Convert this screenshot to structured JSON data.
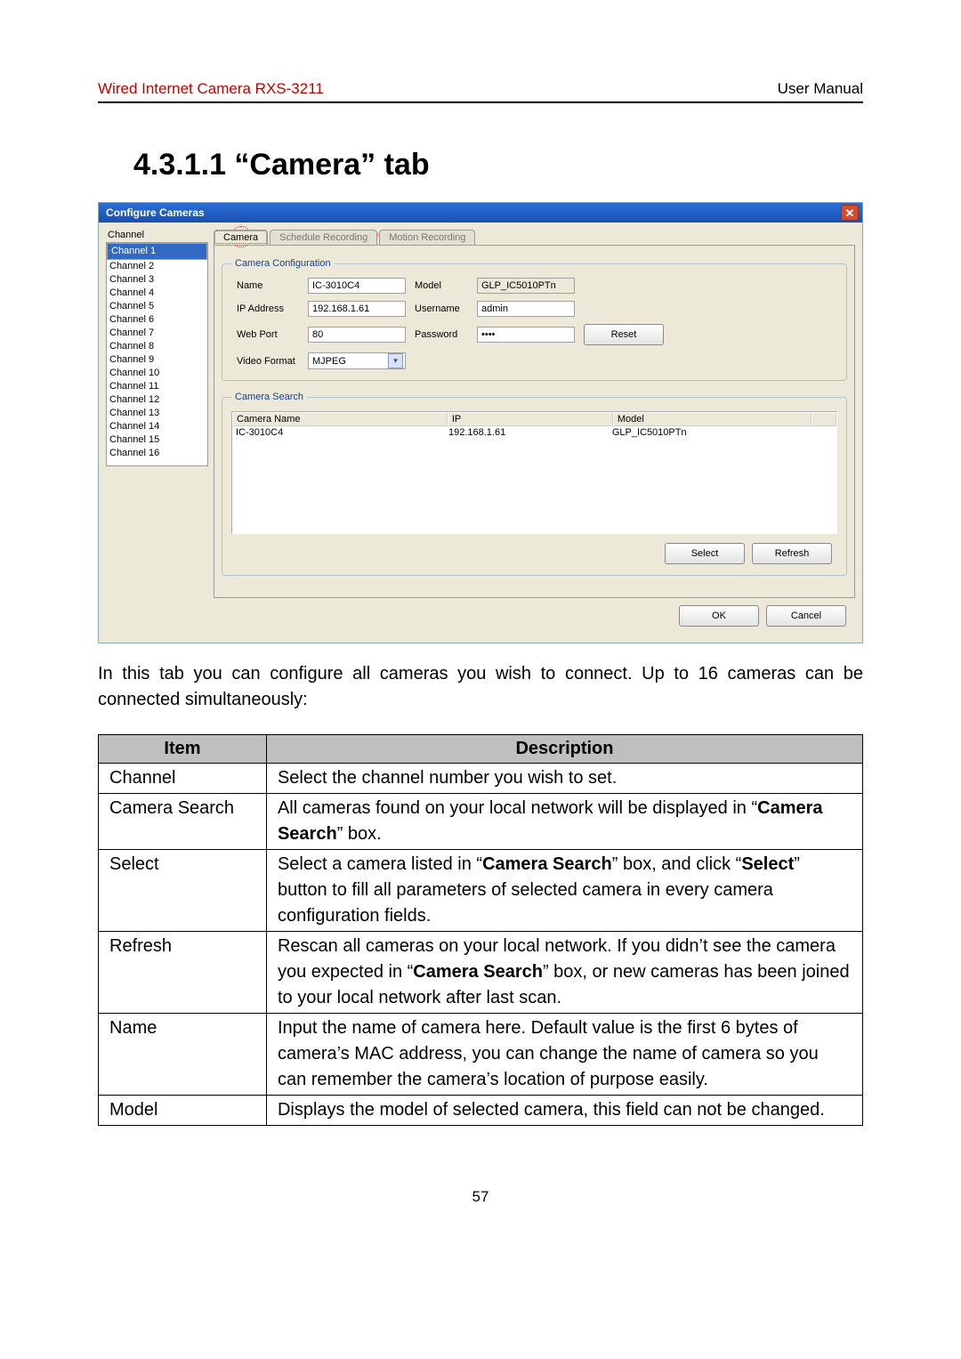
{
  "header": {
    "left": "Wired Internet Camera RXS-3211",
    "right": "User Manual"
  },
  "section_title": "4.3.1.1 “Camera” tab",
  "paragraph": "In this tab you can configure all cameras you wish to connect. Up to 16 cameras can be connected simultaneously:",
  "dialog": {
    "title": "Configure Cameras",
    "channel_label": "Channel",
    "channels": [
      "Channel 1",
      "Channel 2",
      "Channel 3",
      "Channel 4",
      "Channel 5",
      "Channel 6",
      "Channel 7",
      "Channel 8",
      "Channel 9",
      "Channel 10",
      "Channel 11",
      "Channel 12",
      "Channel 13",
      "Channel 14",
      "Channel 15",
      "Channel 16"
    ],
    "tabs": {
      "camera": "Camera",
      "schedule": "Schedule Recording",
      "motion": "Motion Recording"
    },
    "cfg_legend": "Camera Configuration",
    "labels": {
      "name": "Name",
      "ip": "IP Address",
      "port": "Web Port",
      "vf": "Video Format",
      "model": "Model",
      "user": "Username",
      "pass": "Password"
    },
    "values": {
      "name": "IC-3010C4",
      "ip": "192.168.1.61",
      "port": "80",
      "vf": "MJPEG",
      "model": "GLP_IC5010PTn",
      "user": "admin",
      "pass": "••••"
    },
    "reset": "Reset",
    "search_legend": "Camera Search",
    "search_head": {
      "name": "Camera Name",
      "ip": "IP",
      "model": "Model"
    },
    "search_row": {
      "name": "IC-3010C4",
      "ip": "192.168.1.61",
      "model": "GLP_IC5010PTn"
    },
    "buttons": {
      "select": "Select",
      "refresh": "Refresh",
      "ok": "OK",
      "cancel": "Cancel"
    }
  },
  "table": {
    "head": {
      "item": "Item",
      "desc": "Description"
    },
    "rows": [
      {
        "item": "Channel",
        "html": "Select the channel number you wish to set."
      },
      {
        "item": "Camera Search",
        "html": "All cameras found on your local network will be displayed in “<b>Camera Search</b>” box."
      },
      {
        "item": "Select",
        "html": "Select a camera listed in “<b>Camera Search</b>” box, and click “<b>Select</b>” button to fill all parameters of selected camera in every camera configuration fields."
      },
      {
        "item": "Refresh",
        "html": "Rescan all cameras on your local network. If you didn’t see the camera you expected in “<b>Camera Search</b>” box, or new cameras has been joined to your local network after last scan."
      },
      {
        "item": "Name",
        "html": "Input the name of camera here. Default value is the first 6 bytes of camera’s MAC address, you can change the name of camera so you can remember the camera’s location of purpose easily."
      },
      {
        "item": "Model",
        "html": "Displays the model of selected camera, this field can not be changed."
      }
    ]
  },
  "page_number": "57"
}
